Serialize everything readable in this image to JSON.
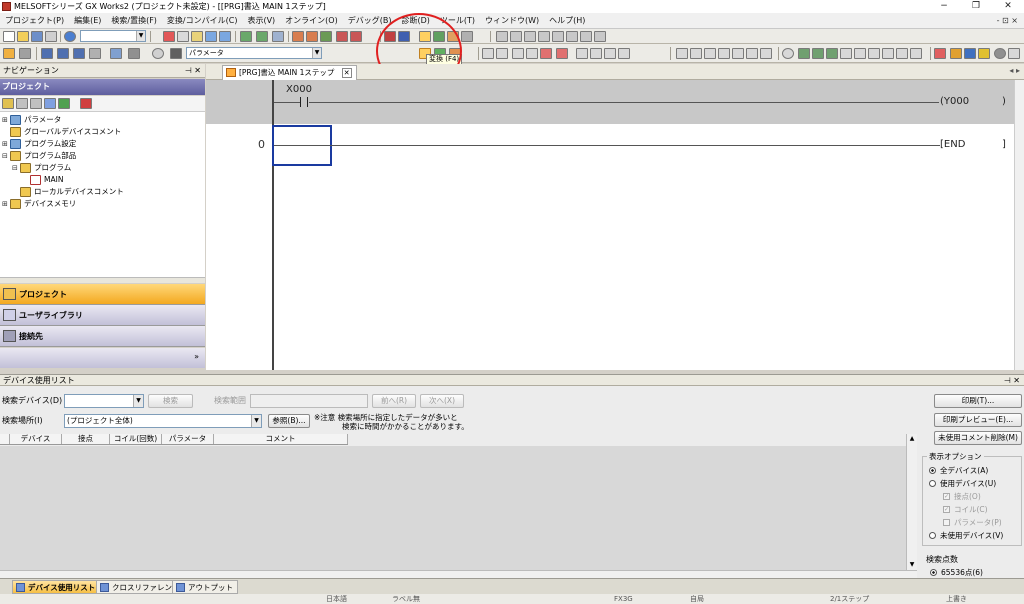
{
  "window": {
    "title": "MELSOFTシリーズ GX Works2 (プロジェクト未設定) - [[PRG]書込 MAIN 1ステップ]"
  },
  "menu": [
    "プロジェクト(P)",
    "編集(E)",
    "検索/置換(F)",
    "変換/コンパイル(C)",
    "表示(V)",
    "オンライン(O)",
    "デバッグ(B)",
    "診断(D)",
    "ツール(T)",
    "ウィンドウ(W)",
    "ヘルプ(H)"
  ],
  "toolbar": {
    "param_combo": "パラメータ",
    "tooltip": "変換 (F4)"
  },
  "navigation": {
    "header": "ナビゲーション",
    "section_title": "プロジェクト",
    "tree": [
      {
        "label": "パラメータ"
      },
      {
        "label": "グローバルデバイスコメント"
      },
      {
        "label": "プログラム設定"
      },
      {
        "label": "プログラム部品"
      },
      {
        "label": "プログラム"
      },
      {
        "label": "MAIN"
      },
      {
        "label": "ローカルデバイスコメント"
      },
      {
        "label": "デバイスメモリ"
      }
    ],
    "tabs": [
      "プロジェクト",
      "ユーザライブラリ",
      "接続先"
    ]
  },
  "editor": {
    "tab_label": "[PRG]書込 MAIN 1ステップ",
    "rung0": {
      "contact": "X000",
      "coil": "(Y000",
      "coil_end": ")"
    },
    "step_number": "0",
    "end_instruction": "[END",
    "end_bracket": "]"
  },
  "device_list": {
    "header": "デバイス使用リスト",
    "search_device_label": "検索デバイス(D)",
    "search_device_value": "",
    "search_button": "検索",
    "search_range_label": "検索範囲",
    "prev_button": "前へ(R)",
    "next_button": "次へ(X)",
    "search_location_label": "検索場所(I)",
    "search_location_value": "(プロジェクト全体)",
    "browse_button": "参照(B)...",
    "note_line1": "※注意 検索場所に指定したデータが多いと",
    "note_line2": "検索に時間がかかることがあります。",
    "columns": [
      "デバイス",
      "接点",
      "コイル(回数)",
      "パラメータ",
      "コメント"
    ],
    "print_button": "印刷(T)...",
    "preview_button": "印刷プレビュー(E)...",
    "delete_comment_button": "未使用コメント削除(M)",
    "display_options_title": "表示オプション",
    "options": {
      "all_devices": "全デバイス(A)",
      "used_devices": "使用デバイス(U)",
      "contact": "接点(O)",
      "coil": "コイル(C)",
      "parameter": "パラメータ(P)",
      "unused_devices": "未使用デバイス(V)"
    },
    "search_points_title": "検索点数",
    "search_points_option": "65536点(6)"
  },
  "bottom_tabs": [
    "デバイス使用リスト",
    "クロスリファレンス",
    "アウトプット"
  ],
  "status": [
    "日本語",
    "ラベル無",
    "FX3G",
    "自局",
    "2/1ステップ",
    "上書き"
  ]
}
